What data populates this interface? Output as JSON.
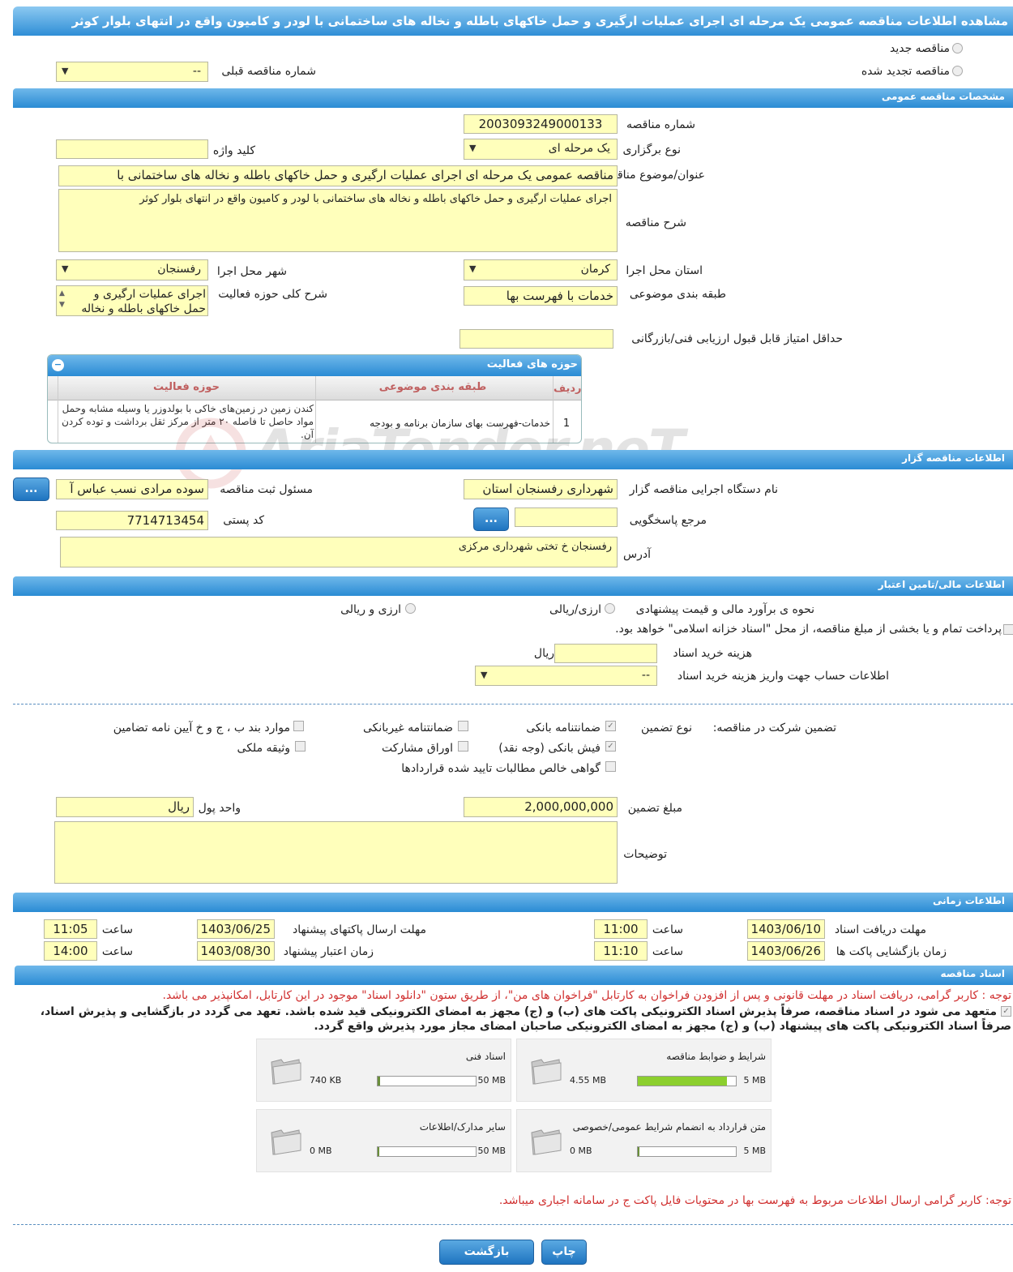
{
  "title": "مشاهده اطلاعات مناقصه عمومی یک مرحله ای اجرای عملیات ارگیری و حمل خاکهای باطله و نخاله های ساختمانی با لودر و کامیون واقع در انتهای بلوار کوثر",
  "top": {
    "new_tender": "مناقصه جدید",
    "renewed_tender": "مناقصه تجدید شده",
    "prev_number_label": "شماره مناقصه قبلی",
    "prev_number_value": "--"
  },
  "sections": {
    "general": "مشخصات مناقصه عمومی",
    "organizer": "اطلاعات مناقصه گزار",
    "finance": "اطلاعات مالی/تامین اعتبار",
    "timing": "اطلاعات زمانی",
    "docs": "اسناد مناقصه"
  },
  "general": {
    "number_label": "شماره مناقصه",
    "number_value": "2003093249000133",
    "type_label": "نوع برگزاری",
    "type_value": "یک مرحله ای",
    "keyword_label": "کلید واژه",
    "keyword_value": "",
    "subject_label": "عنوان/موضوع مناقصه",
    "subject_value": "مناقصه عمومی یک مرحله ای اجرای عملیات ارگیری و حمل خاکهای باطله و نخاله های ساختمانی با",
    "desc_label": "شرح مناقصه",
    "desc_value": "اجرای عملیات ارگیری و حمل خاکهای باطله و نخاله های ساختمانی با لودر و کامیون واقع در انتهای بلوار کوثر",
    "province_label": "استان محل اجرا",
    "province_value": "کرمان",
    "city_label": "شهر محل اجرا",
    "city_value": "رفسنجان",
    "category_label": "طبقه بندی موضوعی",
    "category_value": "خدمات با فهرست بها",
    "scope_label": "شرح کلی حوزه فعالیت",
    "scope_value": "اجرای عملیات ارگیری و حمل خاکهای باطله و نخاله",
    "minscore_label": "حداقل امتیاز قابل قبول ارزیابی فنی/بازرگانی",
    "minscore_value": ""
  },
  "activity": {
    "title": "حوزه های فعالیت",
    "headers": [
      "ردیف",
      "طبقه بندی موضوعی",
      "حوزه فعالیت"
    ],
    "rows": [
      {
        "index": "1",
        "category": "خدمات-فهرست بهای سازمان برنامه و بودجه",
        "scope": "کندن زمین در زمین‌های خاکی با بولدوزر یا وسیله مشابه وحمل مواد حاصل تا فاصله ۲۰ متر از مرکز ثقل برداشت و توده کردن آن."
      }
    ]
  },
  "organizer": {
    "org_label": "نام دستگاه اجرایی مناقصه گزار",
    "org_value": "شهرداری رفسنجان استان",
    "resp_label": "مسئول ثبت مناقصه",
    "resp_value": "سوده مرادی نسب عباس آ",
    "ref_label": "مرجع پاسخگویی",
    "ref_value": "",
    "postal_label": "کد پستی",
    "postal_value": "7714713454",
    "address_label": "آدرس",
    "address_value": "رفسنجان خ تختی شهرداری مرکزی",
    "more_btn": "..."
  },
  "finance": {
    "estimate_label": "نحوه ی برآورد مالی و قیمت پیشنهادی",
    "opt_rial": "ارزی/ریالی",
    "opt_fx": "ارزی و ریالی",
    "treasury_text": "پرداخت تمام و یا بخشی از مبلغ مناقصه، از محل \"اسناد خزانه اسلامی\" خواهد بود.",
    "doc_cost_label": "هزینه خرید اسناد",
    "doc_cost_unit": "ریال",
    "doc_cost_value": "",
    "account_label": "اطلاعات حساب جهت واریز هزینه خرید اسناد",
    "account_value": "--",
    "guarantee_label": "تضمین شرکت در مناقصه:",
    "guarantee_type_label": "نوع تضمین",
    "g_bank": "ضمانتنامه بانکی",
    "g_nonbank": "ضمانتنامه غیربانکی",
    "g_rules": "موارد بند ب ، ج و خ آیین نامه تضامین",
    "g_cash": "فیش بانکی (وجه نقد)",
    "g_bonds": "اوراق مشارکت",
    "g_property": "وثیقه ملکی",
    "g_claims": "گواهی خالص مطالبات تایید شده قراردادها",
    "amount_label": "مبلغ تضمین",
    "amount_value": "2,000,000,000",
    "currency_label": "واحد پول",
    "currency_value": "ریال",
    "notes_label": "توضیحات",
    "notes_value": ""
  },
  "timing": {
    "receive_label": "مهلت دریافت اسناد",
    "receive_date": "1403/06/10",
    "receive_time": "11:00",
    "send_label": "مهلت ارسال پاکتهای پیشنهاد",
    "send_date": "1403/06/25",
    "send_time": "11:05",
    "open_label": "زمان بازگشایی پاکت ها",
    "open_date": "1403/06/26",
    "open_time": "11:10",
    "valid_label": "زمان اعتبار پیشنهاد",
    "valid_date": "1403/08/30",
    "valid_time": "14:00",
    "time_label": "ساعت"
  },
  "docs": {
    "note1": "توجه : کاربر گرامی، دریافت اسناد در مهلت قانونی و پس از افزودن فراخوان به کارتابل \"فراخوان های من\"، از طریق ستون \"دانلود اسناد\" موجود در این کارتابل، امکانپذیر می باشد.",
    "commit1": "متعهد می شود در اسناد مناقصه، صرفاً پذیرش اسناد الکترونیکی پاکت های (ب) و (ج) مجهز به امضای الکترونیکی قید شده باشد. تعهد می گردد در بازگشایی و پذیرش اسناد،",
    "commit2": "صرفاً اسناد الکترونیکی پاکت های پیشنهاد (ب) و (ج) مجهز به امضای الکترونیکی صاحبان امضای مجاز مورد پذیرش واقع گردد.",
    "files": [
      {
        "name": "شرایط و ضوابط مناقصه",
        "used": "4.55 MB",
        "max": "5 MB",
        "fraction": 0.91
      },
      {
        "name": "اسناد فنی",
        "used": "740 KB",
        "max": "50 MB",
        "fraction": 0.015
      },
      {
        "name": "متن قرارداد به انضمام شرایط عمومی/خصوصی",
        "used": "0 MB",
        "max": "5 MB",
        "fraction": 0
      },
      {
        "name": "سایر مدارک/اطلاعات",
        "used": "0 MB",
        "max": "50 MB",
        "fraction": 0
      }
    ],
    "note2": "توجه: کاربر گرامی ارسال اطلاعات مربوط به فهرست بها در محتویات فایل پاکت ج در سامانه اجباری میباشد."
  },
  "buttons": {
    "back": "بازگشت",
    "print": "چاپ"
  },
  "watermark": "AriaTender.neT",
  "colors": {
    "accent": "#2a8bd4",
    "field": "#ffffbb",
    "progress": "#8ccf2e",
    "note": "#d03030"
  }
}
